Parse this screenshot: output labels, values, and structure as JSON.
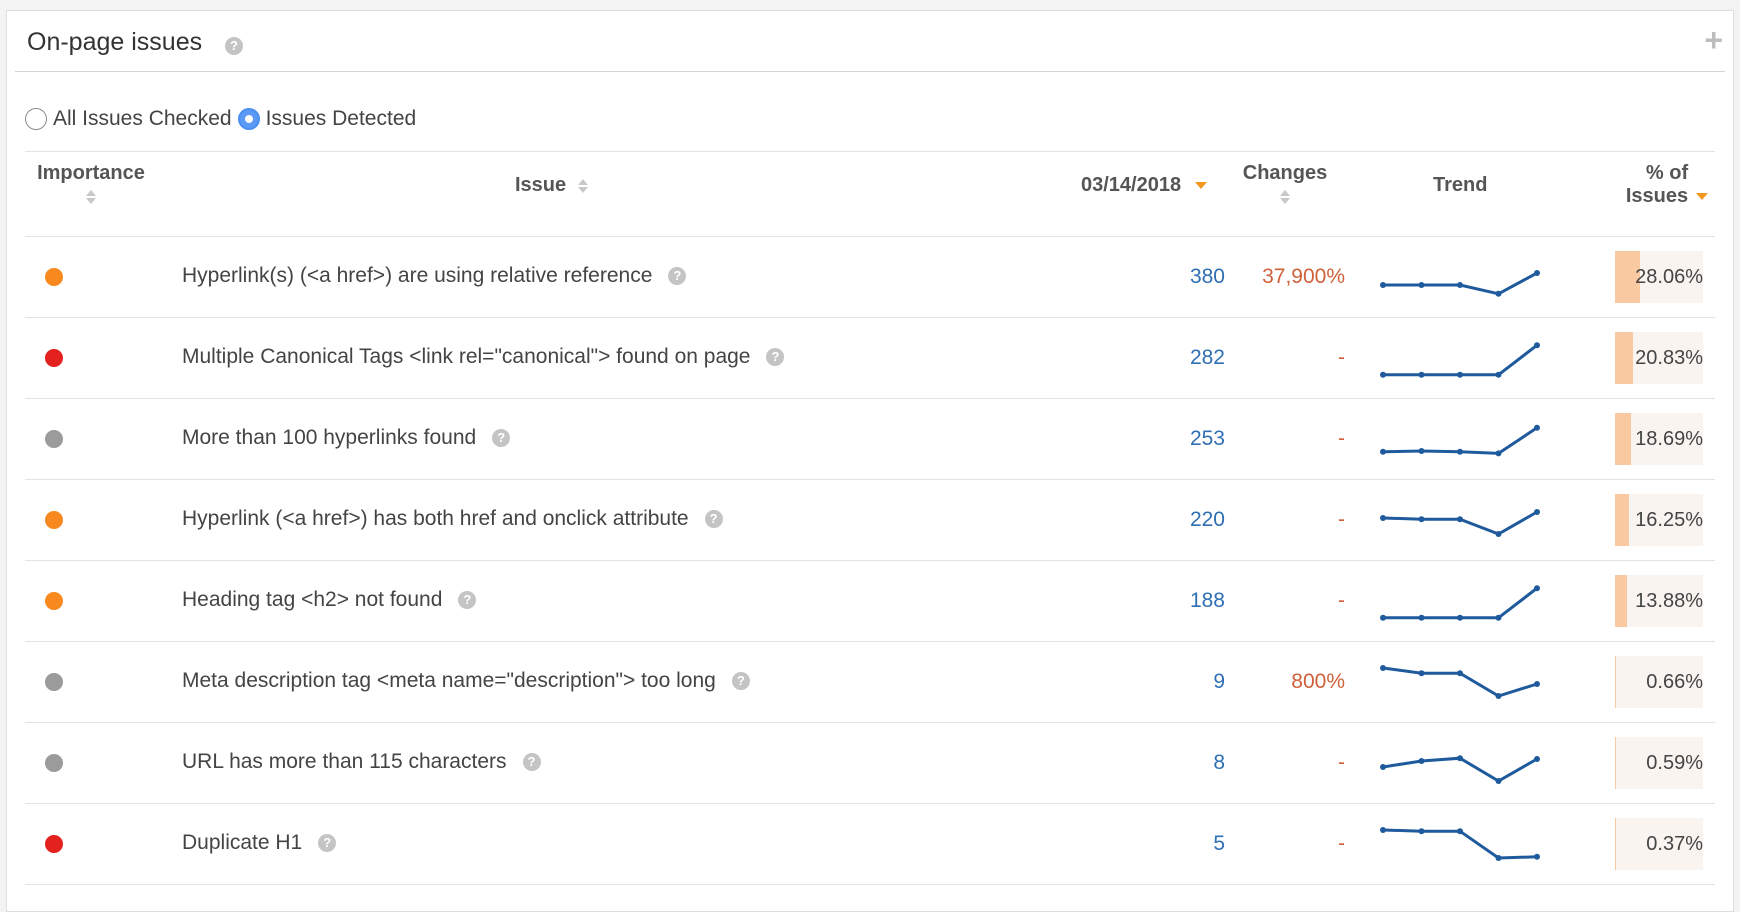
{
  "widget": {
    "title": "On-page issues",
    "help_glyph": "?",
    "add_glyph": "+"
  },
  "filters": {
    "options": [
      {
        "label": "All Issues Checked",
        "checked": false
      },
      {
        "label": "Issues Detected",
        "checked": true
      }
    ]
  },
  "columns": {
    "importance": "Importance",
    "issue": "Issue",
    "date": "03/14/2018",
    "changes": "Changes",
    "trend": "Trend",
    "pct_line1": "% of",
    "pct_line2": "Issues"
  },
  "importance_colors": {
    "high": "#e3211e",
    "medium": "#f7891f",
    "low": "#9b9b9b"
  },
  "trend_color": "#1f5a9c",
  "rows": [
    {
      "importance": "medium",
      "issue": "Hyperlink(s) (<a href>) are using relative reference",
      "count": "380",
      "change": "37,900%",
      "pct": "28.06%",
      "pct_value": 28.06,
      "trend": [
        0.7,
        0.7,
        0.7,
        0.92,
        0.4
      ]
    },
    {
      "importance": "high",
      "issue": "Multiple Canonical Tags <link rel=\"canonical\"> found on page",
      "count": "282",
      "change": "-",
      "pct": "20.83%",
      "pct_value": 20.83,
      "trend": [
        0.92,
        0.92,
        0.92,
        0.92,
        0.18
      ]
    },
    {
      "importance": "low",
      "issue": "More than 100 hyperlinks found",
      "count": "253",
      "change": "-",
      "pct": "18.69%",
      "pct_value": 18.69,
      "trend": [
        0.82,
        0.8,
        0.82,
        0.86,
        0.22
      ]
    },
    {
      "importance": "medium",
      "issue": "Hyperlink (<a href>) has both href and onclick attribute",
      "count": "220",
      "change": "-",
      "pct": "16.25%",
      "pct_value": 16.25,
      "trend": [
        0.45,
        0.48,
        0.48,
        0.85,
        0.3
      ]
    },
    {
      "importance": "medium",
      "issue": "Heading tag <h2> not found",
      "count": "188",
      "change": "-",
      "pct": "13.88%",
      "pct_value": 13.88,
      "trend": [
        0.92,
        0.92,
        0.92,
        0.92,
        0.18
      ]
    },
    {
      "importance": "low",
      "issue": "Meta description tag <meta name=\"description\"> too long",
      "count": "9",
      "change": "800%",
      "pct": "0.66%",
      "pct_value": 0.66,
      "trend": [
        0.15,
        0.28,
        0.28,
        0.85,
        0.55
      ]
    },
    {
      "importance": "low",
      "issue": "URL has more than 115 characters",
      "count": "8",
      "change": "-",
      "pct": "0.59%",
      "pct_value": 0.59,
      "trend": [
        0.6,
        0.45,
        0.38,
        0.95,
        0.4
      ]
    },
    {
      "importance": "high",
      "issue": "Duplicate H1",
      "count": "5",
      "change": "-",
      "pct": "0.37%",
      "pct_value": 0.37,
      "trend": [
        0.15,
        0.18,
        0.18,
        0.85,
        0.82
      ]
    }
  ]
}
